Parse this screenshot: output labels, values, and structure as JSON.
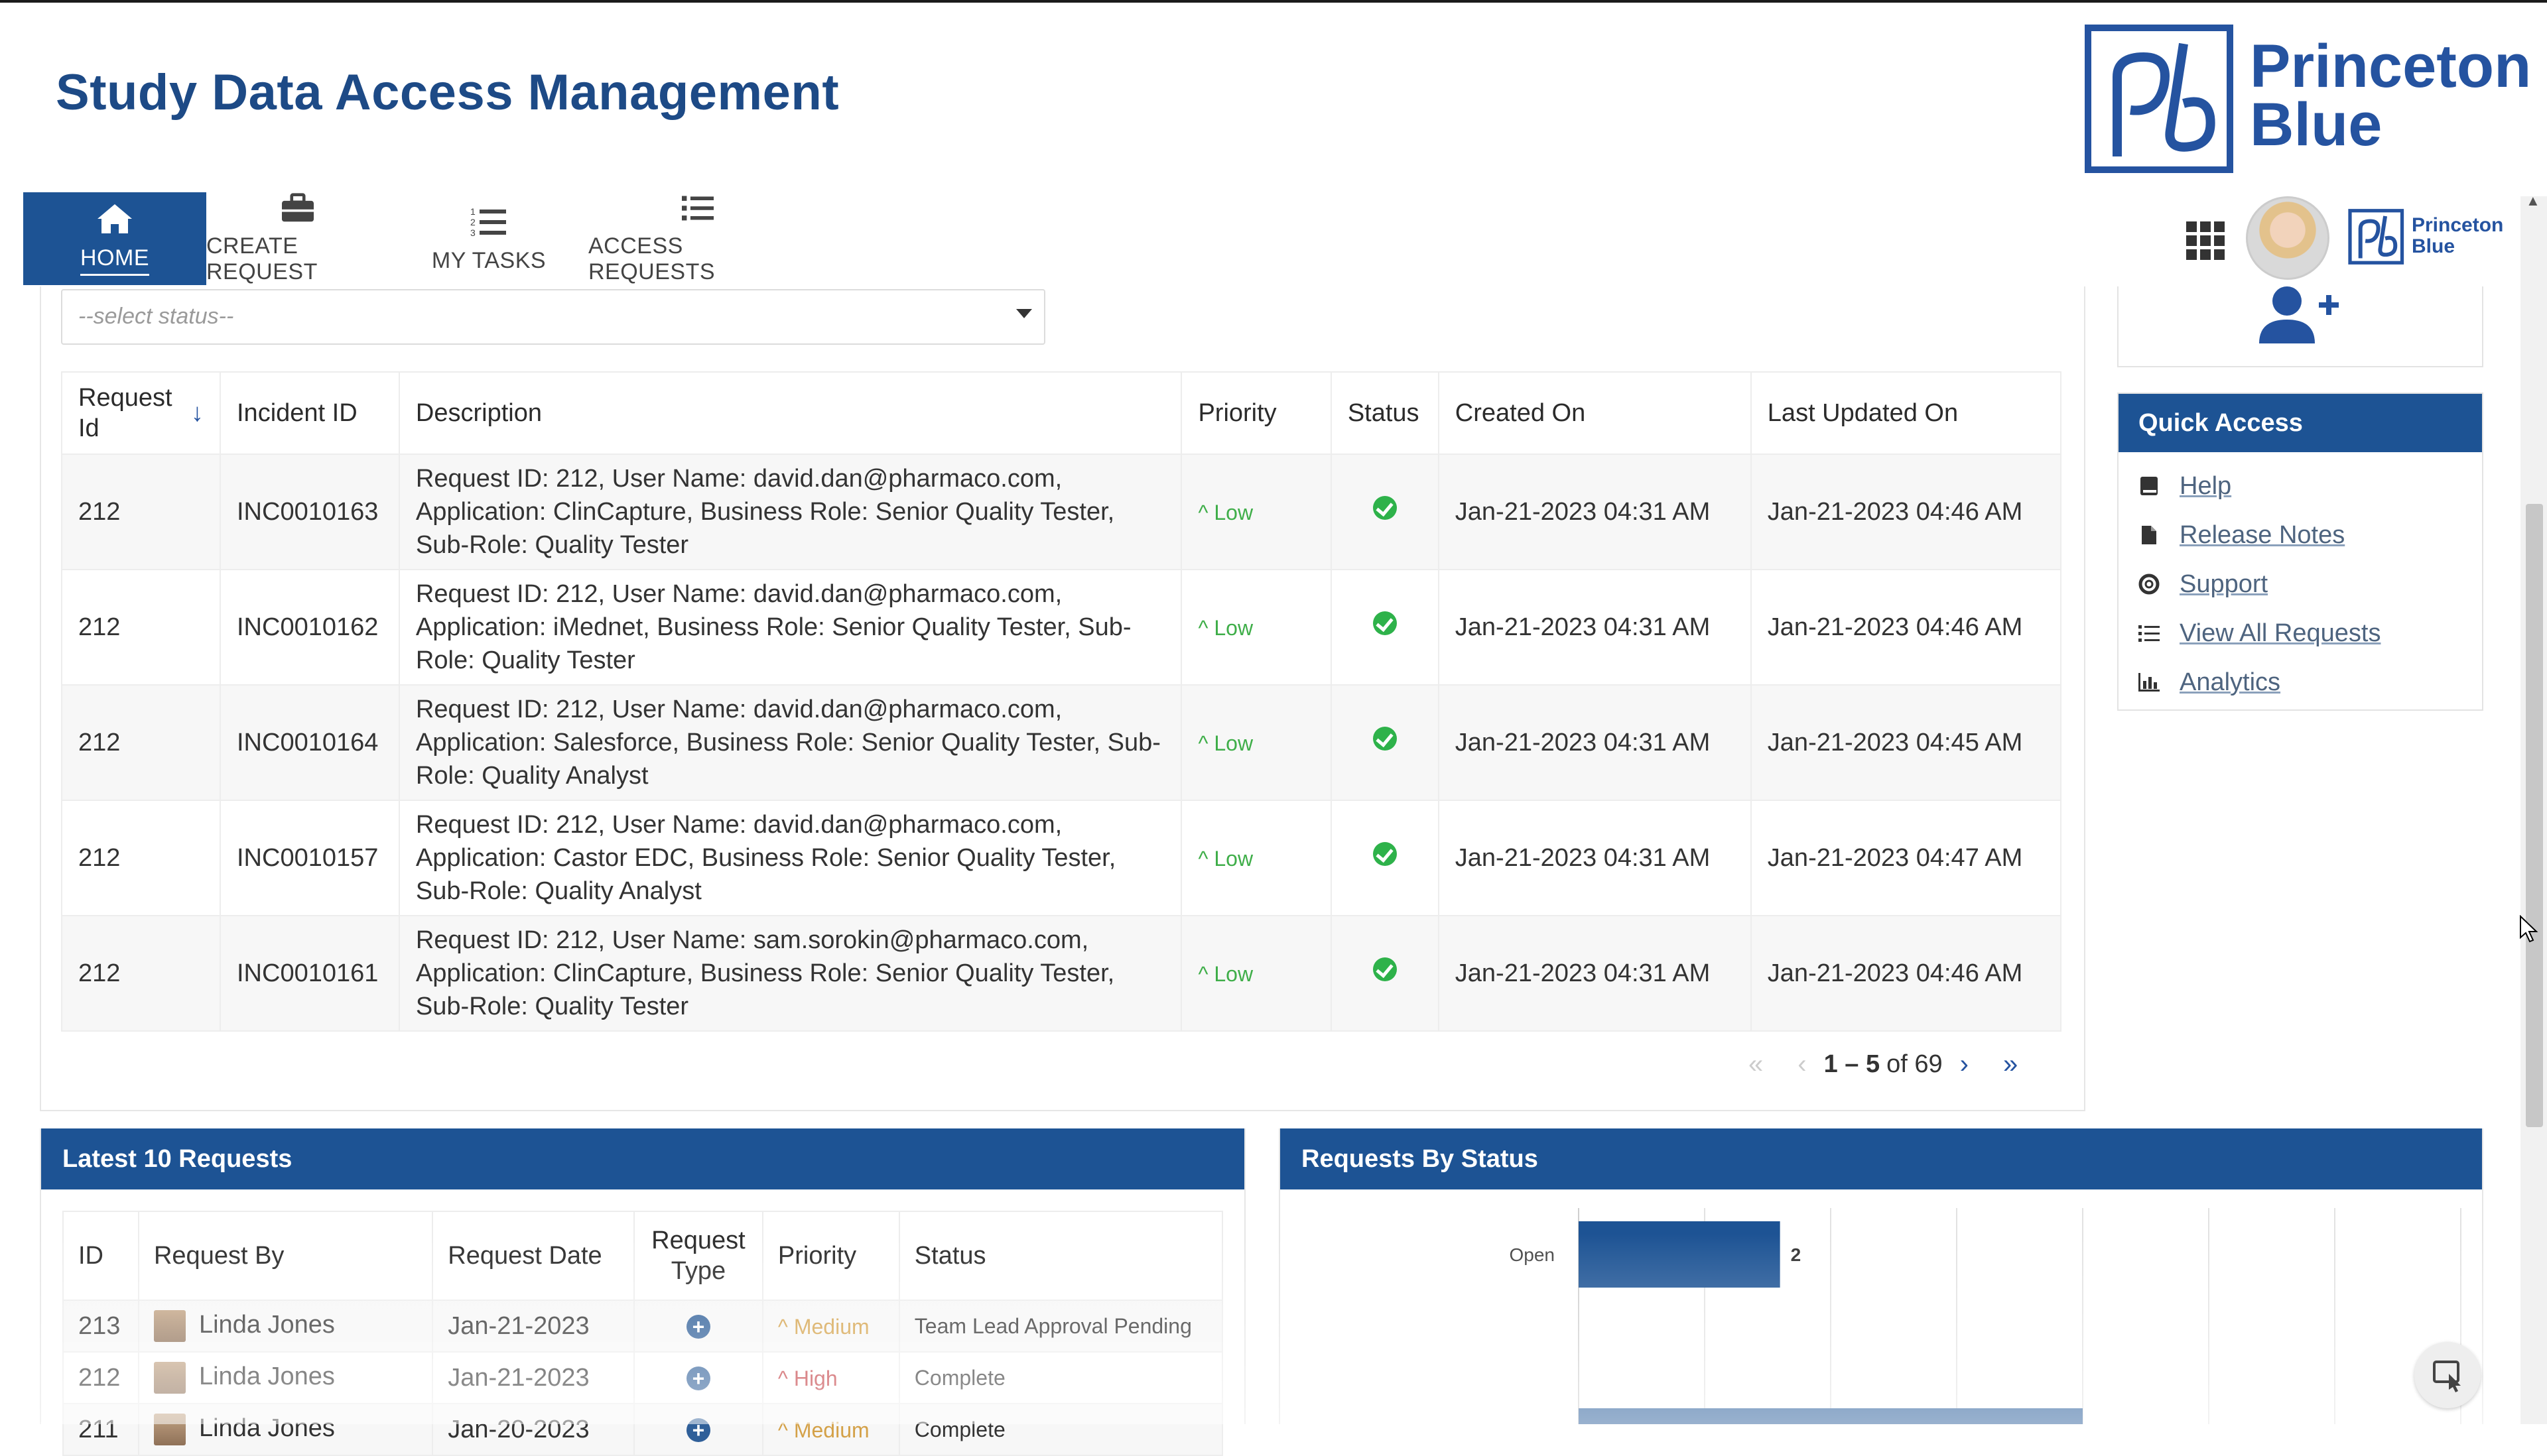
{
  "app": {
    "title": "Study Data Access Management"
  },
  "brand": {
    "line1": "Princeton",
    "line2": "Blue"
  },
  "nav": {
    "items": [
      {
        "label": "HOME",
        "icon": "home-icon",
        "active": true
      },
      {
        "label": "CREATE REQUEST",
        "icon": "briefcase-icon",
        "active": false
      },
      {
        "label": "MY TASKS",
        "icon": "numbered-list-icon",
        "active": false
      },
      {
        "label": "ACCESS REQUESTS",
        "icon": "list-icon",
        "active": false
      }
    ]
  },
  "header_right": {
    "mini_brand_line1": "Princeton",
    "mini_brand_line2": "Blue",
    "apps_icon": "apps-grid-icon"
  },
  "filter": {
    "status_placeholder": "--select status--"
  },
  "requests_table": {
    "columns": [
      "Request Id",
      "Incident ID",
      "Description",
      "Priority",
      "Status",
      "Created On",
      "Last Updated On"
    ],
    "rows": [
      {
        "request_id": "212",
        "incident_id": "INC0010163",
        "description": "Request ID: 212, User Name: david.dan@pharmaco.com, Application: ClinCapture, Business Role: Senior Quality Tester, Sub-Role: Quality Tester",
        "priority": "Low",
        "status": "complete",
        "created_on": "Jan-21-2023 04:31 AM",
        "updated_on": "Jan-21-2023 04:46 AM"
      },
      {
        "request_id": "212",
        "incident_id": "INC0010162",
        "description": "Request ID: 212, User Name: david.dan@pharmaco.com, Application: iMednet, Business Role: Senior Quality Tester, Sub-Role: Quality Tester",
        "priority": "Low",
        "status": "complete",
        "created_on": "Jan-21-2023 04:31 AM",
        "updated_on": "Jan-21-2023 04:46 AM"
      },
      {
        "request_id": "212",
        "incident_id": "INC0010164",
        "description": "Request ID: 212, User Name: david.dan@pharmaco.com, Application: Salesforce, Business Role: Senior Quality Tester, Sub-Role: Quality Analyst",
        "priority": "Low",
        "status": "complete",
        "created_on": "Jan-21-2023 04:31 AM",
        "updated_on": "Jan-21-2023 04:45 AM"
      },
      {
        "request_id": "212",
        "incident_id": "INC0010157",
        "description": "Request ID: 212, User Name: david.dan@pharmaco.com, Application: Castor EDC, Business Role: Senior Quality Tester, Sub-Role: Quality Analyst",
        "priority": "Low",
        "status": "complete",
        "created_on": "Jan-21-2023 04:31 AM",
        "updated_on": "Jan-21-2023 04:47 AM"
      },
      {
        "request_id": "212",
        "incident_id": "INC0010161",
        "description": "Request ID: 212, User Name: sam.sorokin@pharmaco.com, Application: ClinCapture, Business Role: Senior Quality Tester, Sub-Role: Quality Tester",
        "priority": "Low",
        "status": "complete",
        "created_on": "Jan-21-2023 04:31 AM",
        "updated_on": "Jan-21-2023 04:46 AM"
      }
    ]
  },
  "pagination": {
    "range": "1 – 5",
    "of_text": "of 69"
  },
  "quick_access": {
    "title": "Quick Access",
    "items": [
      {
        "label": "Help",
        "icon": "book-icon"
      },
      {
        "label": "Release Notes",
        "icon": "document-icon"
      },
      {
        "label": "Support",
        "icon": "lifebuoy-icon"
      },
      {
        "label": "View All Requests",
        "icon": "list-icon"
      },
      {
        "label": "Analytics",
        "icon": "bar-chart-icon"
      }
    ]
  },
  "latest_requests": {
    "title": "Latest 10 Requests",
    "columns": [
      "ID",
      "Request By",
      "Request Date",
      "Request Type",
      "Priority",
      "Status"
    ],
    "rows": [
      {
        "id": "213",
        "by": "Linda Jones",
        "date": "Jan-21-2023",
        "priority": "Medium",
        "status": "Team Lead Approval Pending"
      },
      {
        "id": "212",
        "by": "Linda Jones",
        "date": "Jan-21-2023",
        "priority": "High",
        "status": "Complete"
      },
      {
        "id": "211",
        "by": "Linda Jones",
        "date": "Jan-20-2023",
        "priority": "Medium",
        "status": "Complete"
      }
    ]
  },
  "requests_by_status": {
    "title": "Requests By Status"
  },
  "chart_data": {
    "type": "bar",
    "orientation": "horizontal",
    "categories": [
      "Open"
    ],
    "values": [
      2
    ],
    "grid": true,
    "color": "#1d5394"
  }
}
